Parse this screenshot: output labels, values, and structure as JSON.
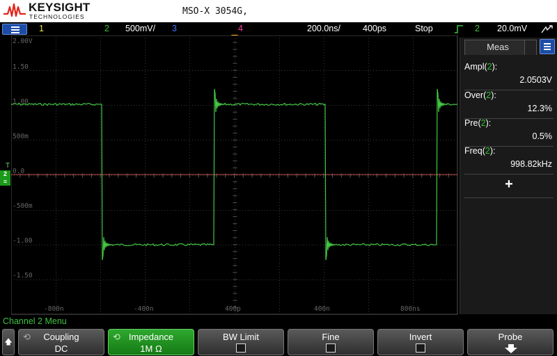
{
  "header": {
    "brand": "KEYSIGHT",
    "brand_sub": "TECHNOLOGIES",
    "model": "MSO-X 3054G,"
  },
  "status_bar": {
    "menu_icon": "menu-icon",
    "ch1": "1",
    "ch2": "2",
    "ch2_scale": "500mV/",
    "ch3": "3",
    "ch4": "4",
    "timebase": "200.0ns/",
    "delay": "400ps",
    "run_state": "Stop",
    "trigger_icon": "rising-edge-trigger-icon",
    "trigger_source": "2",
    "trigger_level": "20.0mV",
    "extra_icon": "scroll-arrows-icon"
  },
  "graticule": {
    "y_labels": [
      "2.00V",
      "1.50",
      "1.00",
      "500m",
      "0.0",
      "-500m",
      "-1.00",
      "-1.50"
    ],
    "x_labels": [
      "-800n",
      "-400n",
      "400p",
      "400n",
      "800ns"
    ]
  },
  "markers": {
    "ch2_marker": "2",
    "trigger_marker": "T"
  },
  "meas": {
    "tab_label": "Meas",
    "items": [
      {
        "name": "Ampl",
        "src": "2",
        "value": "2.0503V"
      },
      {
        "name": "Over",
        "src": "2",
        "value": "12.3%"
      },
      {
        "name": "Pre",
        "src": "2",
        "value": "0.5%"
      },
      {
        "name": "Freq",
        "src": "2",
        "value": "998.82kHz"
      }
    ],
    "add_label": "+"
  },
  "softkeys": {
    "menu_title": "Channel 2 Menu",
    "coupling": {
      "label": "Coupling",
      "value": "DC"
    },
    "impedance": {
      "label": "Impedance",
      "value": "1M Ω"
    },
    "bw_limit": {
      "label": "BW Limit"
    },
    "fine": {
      "label": "Fine"
    },
    "invert": {
      "label": "Invert"
    },
    "probe": {
      "label": "Probe"
    }
  },
  "colors": {
    "ch1": "#f2e14b",
    "ch2": "#3ec23e",
    "ch3": "#3f74ff",
    "ch4": "#ff3fa6",
    "trigger": "#ff9a1a"
  }
}
